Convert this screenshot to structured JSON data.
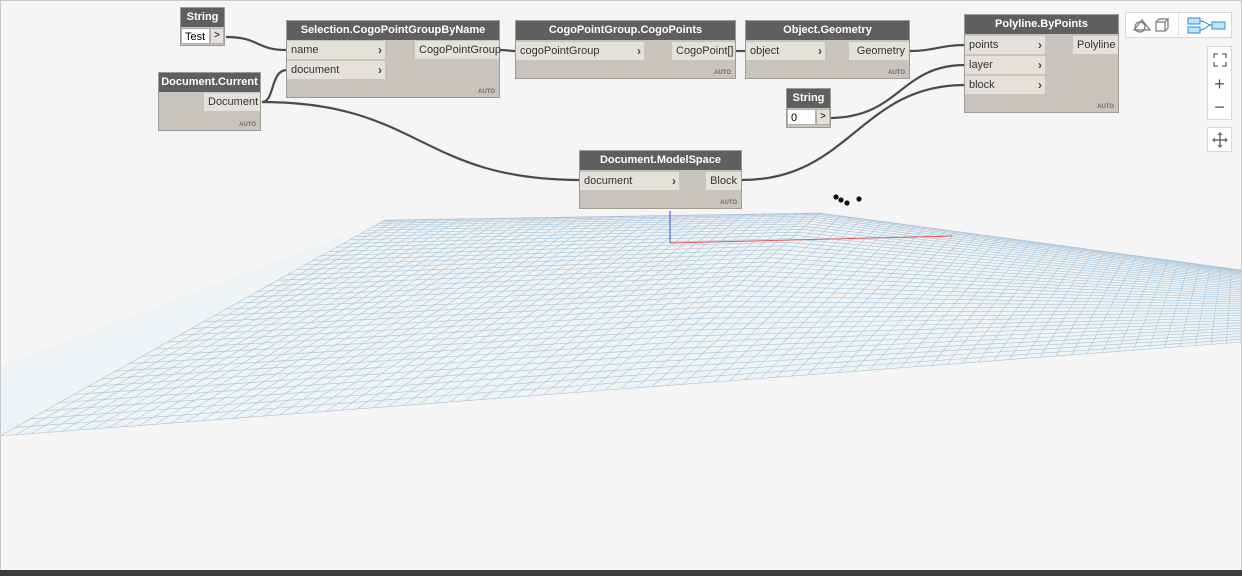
{
  "nodes": {
    "string_test": {
      "title": "String",
      "value": "Test",
      "out_arrow": ">"
    },
    "doc_current": {
      "title": "Document.Current",
      "output": "Document",
      "lacing": "AUTO"
    },
    "selection": {
      "title": "Selection.CogoPointGroupByName",
      "inputs": [
        "name",
        "document"
      ],
      "output": "CogoPointGroup",
      "lacing": "AUTO"
    },
    "cogopoints": {
      "title": "CogoPointGroup.CogoPoints",
      "inputs": [
        "cogoPointGroup"
      ],
      "output": "CogoPoint[]",
      "lacing": "AUTO"
    },
    "obj_geom": {
      "title": "Object.Geometry",
      "inputs": [
        "object"
      ],
      "output": "Geometry",
      "lacing": "AUTO"
    },
    "polyline": {
      "title": "Polyline.ByPoints",
      "inputs": [
        "points",
        "layer",
        "block"
      ],
      "output": "Polyline",
      "lacing": "AUTO"
    },
    "string_zero": {
      "title": "String",
      "value": "0",
      "out_arrow": ">"
    },
    "modelspace": {
      "title": "Document.ModelSpace",
      "inputs": [
        "document"
      ],
      "output": "Block",
      "lacing": "AUTO"
    }
  },
  "port_arrow": "›",
  "colors": {
    "wire": "#4a4a4a",
    "node_header": "#5f5f5f",
    "node_body": "#c8c4bd",
    "grid": "#a9c4d8",
    "axis_x": "#e05a5a",
    "axis_y": "#3b4fd8",
    "accent": "#2a8fd6"
  },
  "controls": {
    "toggle_geometry_icon": "geometry-view-icon",
    "toggle_graph_icon": "graph-view-icon",
    "zoom_fit_icon": "zoom-fit-icon",
    "zoom_in_icon": "zoom-in-icon",
    "zoom_out_icon": "zoom-out-icon",
    "pan_icon": "pan-icon",
    "zoom_in_glyph": "+",
    "zoom_out_glyph": "−"
  }
}
